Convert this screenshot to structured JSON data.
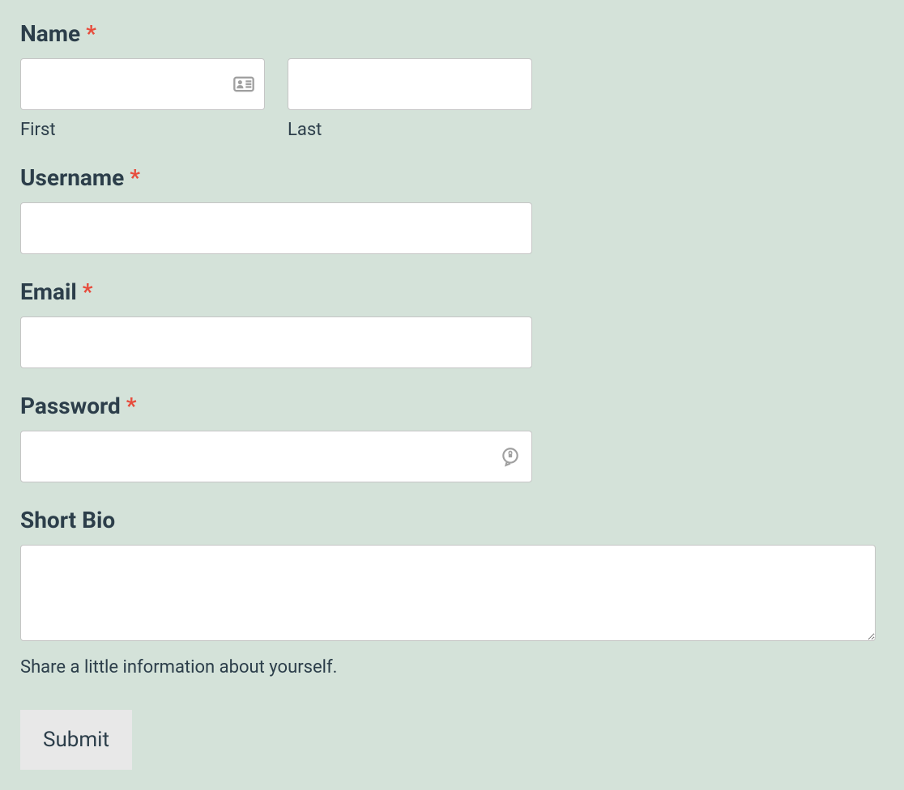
{
  "form": {
    "name": {
      "label": "Name",
      "required_mark": "*",
      "first_sublabel": "First",
      "last_sublabel": "Last",
      "first_value": "",
      "last_value": ""
    },
    "username": {
      "label": "Username",
      "required_mark": "*",
      "value": ""
    },
    "email": {
      "label": "Email",
      "required_mark": "*",
      "value": ""
    },
    "password": {
      "label": "Password",
      "required_mark": "*",
      "value": ""
    },
    "bio": {
      "label": "Short Bio",
      "value": "",
      "help_text": "Share a little information about yourself."
    },
    "submit_label": "Submit"
  }
}
